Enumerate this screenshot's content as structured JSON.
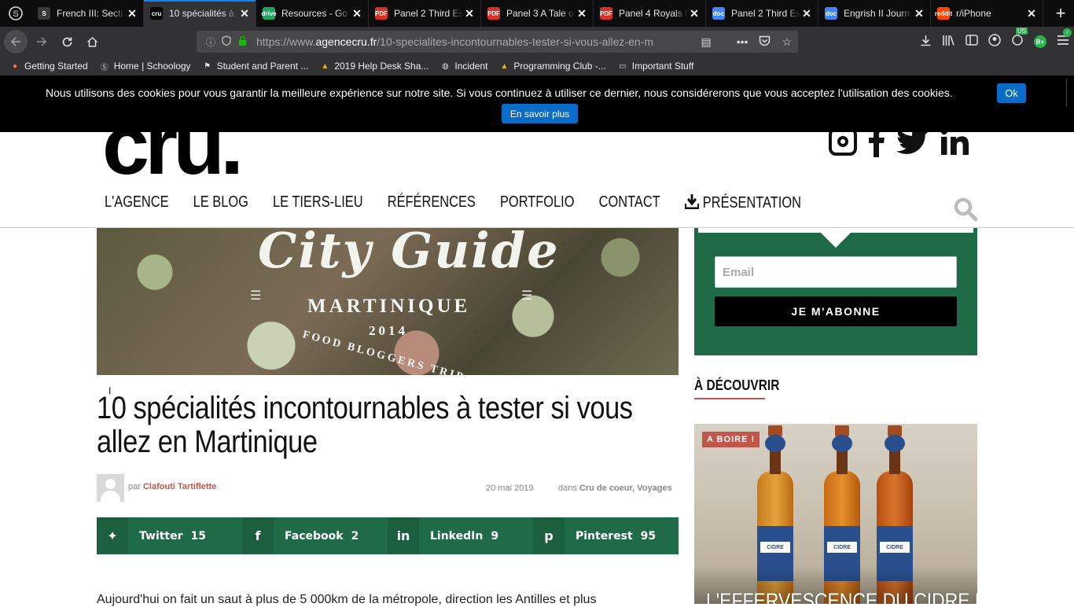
{
  "browser": {
    "tabs": [
      {
        "title": "French III: Secti",
        "favicon": "S",
        "color": "#3a3a3a"
      },
      {
        "title": "10 spécialités à",
        "favicon": "cru",
        "color": "#000000",
        "active": true
      },
      {
        "title": "Resources - Go",
        "favicon": "drive",
        "color": "#1fa463"
      },
      {
        "title": "Panel 2 Third Es",
        "favicon": "PDF",
        "color": "#d93025"
      },
      {
        "title": "Panel 3 A Tale o",
        "favicon": "PDF",
        "color": "#d93025"
      },
      {
        "title": "Panel 4 Royals I",
        "favicon": "PDF",
        "color": "#d93025"
      },
      {
        "title": "Panel 2 Third Es",
        "favicon": "doc",
        "color": "#4285f4"
      },
      {
        "title": "Engrish II Journ",
        "favicon": "doc",
        "color": "#4285f4"
      },
      {
        "title": "r/iPhone",
        "favicon": "reddit",
        "color": "#ff4500"
      }
    ],
    "url_prefix": "https://www.",
    "url_domain": "agencecru.fr",
    "url_path": "/10-specialites-incontournables-tester-si-vous-allez-en-m",
    "bookmarks": [
      {
        "label": "Getting Started",
        "icon": "firefox-icon"
      },
      {
        "label": "Home | Schoology",
        "icon": "schoology-icon"
      },
      {
        "label": "Student and Parent ...",
        "icon": "flag-icon"
      },
      {
        "label": "2019 Help Desk Sha...",
        "icon": "drive-icon"
      },
      {
        "label": "Incident",
        "icon": "globe-icon"
      },
      {
        "label": "Programming Club -...",
        "icon": "drive-icon"
      },
      {
        "label": "Important Stuff",
        "icon": "folder-icon"
      }
    ],
    "ext_badge": "US",
    "ext_label": "B+"
  },
  "cookie": {
    "text": "Nous utilisons des cookies pour vous garantir la meilleure expérience sur notre site. Si vous continuez à utiliser ce dernier, nous considérerons que vous acceptez l'utilisation des cookies.",
    "ok_label": "Ok",
    "more_label": "En savoir plus"
  },
  "site": {
    "logo": "cru.",
    "nav": [
      "L'AGENCE",
      "LE BLOG",
      "LE TIERS-LIEU",
      "RÉFÉRENCES",
      "PORTFOLIO",
      "CONTACT",
      "PRÉSENTATION"
    ]
  },
  "hero": {
    "title": "City Guide",
    "subtitle": "MARTINIQUE",
    "year": "2014",
    "tagline": "FOOD BLOGGERS TRIP"
  },
  "article": {
    "title": "10 spécialités incontournables à tester si vous allez en Martinique",
    "by_prefix": "par",
    "author": "Clafouti Tartiflette",
    "date": "20 mai 2019",
    "cat_prefix": "dans",
    "categories": "Cru de coeur, Voyages",
    "body_start": "Aujourd'hui on fait un saut à plus de 5 000km de la métropole, direction les Antilles et plus"
  },
  "share": [
    {
      "label": "Twitter",
      "count": "15",
      "icon": "twitter-icon"
    },
    {
      "label": "Facebook",
      "count": "2",
      "icon": "facebook-icon"
    },
    {
      "label": "LinkedIn",
      "count": "9",
      "icon": "linkedin-icon"
    },
    {
      "label": "Pinterest",
      "count": "95",
      "icon": "pinterest-icon"
    }
  ],
  "sidebar": {
    "email_placeholder": "Email",
    "subscribe_label": "JE M'ABONNE",
    "discover_title": "À DÉCOUVRIR",
    "promo_badge": "A BOIRE !",
    "promo_title": "L'EFFERVESCENCE DU CIDRE FRANÇAIS"
  },
  "colors": {
    "brand_green": "#1f6b48",
    "accent_red": "#c0574a",
    "cookie_button": "#0a6cc6"
  }
}
